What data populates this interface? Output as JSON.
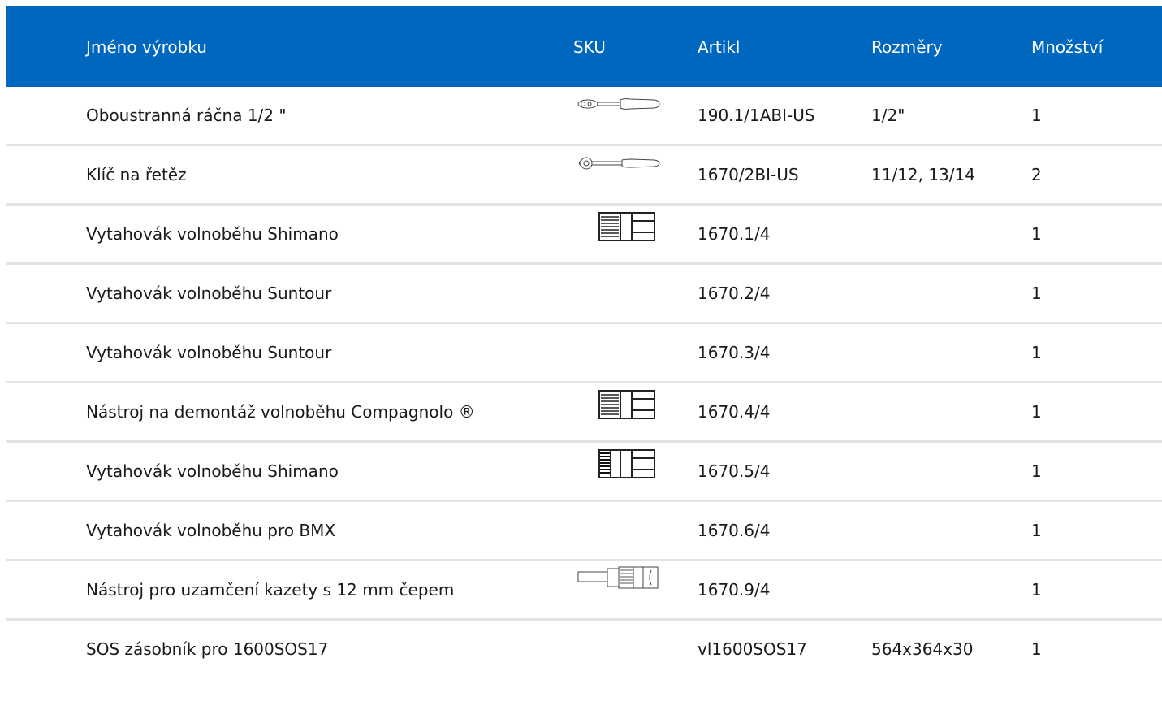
{
  "table": {
    "headers": {
      "name": "Jméno výrobku",
      "sku": "SKU",
      "article": "Artikl",
      "dimensions": "Rozměry",
      "quantity": "Množství"
    },
    "rows": [
      {
        "name": "Oboustranná ráčna 1/2 \"",
        "icon": "ratchet-icon",
        "article": "190.1/1ABI-US",
        "dimensions": "1/2\"",
        "quantity": "1"
      },
      {
        "name": "Klíč na řetěz",
        "icon": "chain-wrench-icon",
        "article": "1670/2BI-US",
        "dimensions": "11/12, 13/14",
        "quantity": "2"
      },
      {
        "name": "Vytahovák volnoběhu Shimano",
        "icon": "freewheel-remover-icon",
        "article": "1670.1/4",
        "dimensions": "",
        "quantity": "1"
      },
      {
        "name": "Vytahovák volnoběhu Suntour",
        "icon": "",
        "article": "1670.2/4",
        "dimensions": "",
        "quantity": "1"
      },
      {
        "name": "Vytahovák volnoběhu Suntour",
        "icon": "",
        "article": "1670.3/4",
        "dimensions": "",
        "quantity": "1"
      },
      {
        "name": "Nástroj na demontáž volnoběhu Compagnolo ®",
        "icon": "freewheel-remover-icon",
        "article": "1670.4/4",
        "dimensions": "",
        "quantity": "1"
      },
      {
        "name": "Vytahovák volnoběhu Shimano",
        "icon": "freewheel-remover-dark-icon",
        "article": "1670.5/4",
        "dimensions": "",
        "quantity": "1"
      },
      {
        "name": "Vytahovák volnoběhu pro BMX",
        "icon": "",
        "article": "1670.6/4",
        "dimensions": "",
        "quantity": "1"
      },
      {
        "name": "Nástroj pro uzamčení kazety s 12 mm čepem",
        "icon": "cassette-lockring-tool-icon",
        "article": "1670.9/4",
        "dimensions": "",
        "quantity": "1"
      },
      {
        "name": "SOS zásobník pro 1600SOS17",
        "icon": "",
        "article": "vl1600SOS17",
        "dimensions": "564x364x30",
        "quantity": "1"
      }
    ]
  },
  "colors": {
    "header_bg": "#0067bf",
    "header_text": "#ffffff",
    "row_divider": "#e4e4e4"
  }
}
